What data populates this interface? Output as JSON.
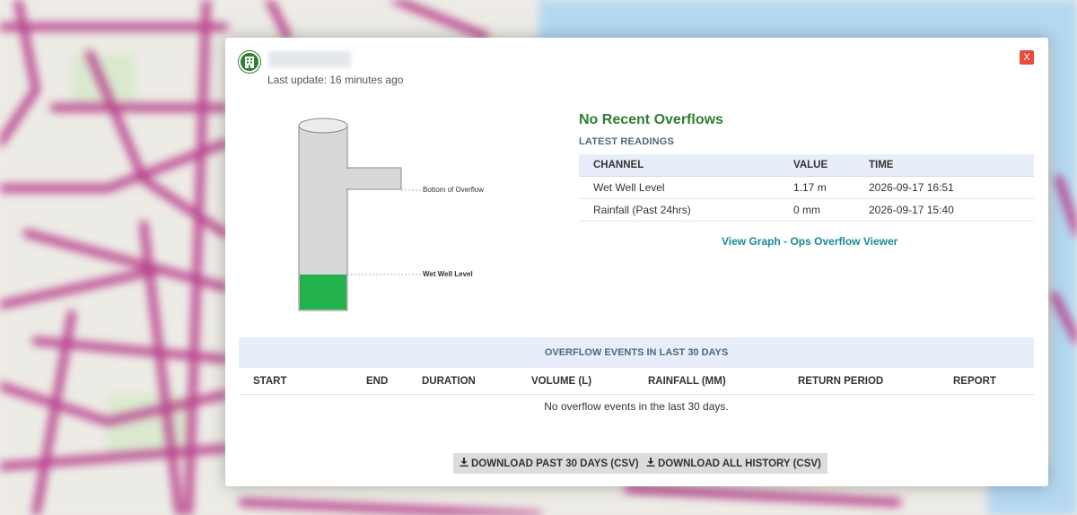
{
  "header": {
    "last_update": "Last update: 16 minutes ago",
    "close_label": "X"
  },
  "diagram": {
    "overflow_label": "Bottom of Overflow",
    "level_label": "Wet Well Level"
  },
  "status": {
    "title": "No Recent Overflows",
    "color": "#2e7d32"
  },
  "readings": {
    "title": "LATEST READINGS",
    "columns": [
      "CHANNEL",
      "VALUE",
      "TIME"
    ],
    "rows": [
      {
        "channel": "Wet Well Level",
        "value": "1.17 m",
        "time": "2026-09-17 16:51"
      },
      {
        "channel": "Rainfall (Past 24hrs)",
        "value": "0 mm",
        "time": "2026-09-17 15:40"
      }
    ],
    "graph_link": "View Graph - Ops Overflow Viewer"
  },
  "events": {
    "title": "OVERFLOW EVENTS IN LAST 30 DAYS",
    "columns": [
      "START",
      "END",
      "DURATION",
      "VOLUME (L)",
      "RAINFALL (MM)",
      "RETURN PERIOD",
      "REPORT"
    ],
    "empty_message": "No overflow events in the last 30 days."
  },
  "downloads": {
    "past_30": "DOWNLOAD PAST 30 DAYS (CSV)",
    "all_history": "DOWNLOAD ALL HISTORY (CSV)"
  },
  "colors": {
    "accent_link": "#1a8a94",
    "level_fill": "#22b14c",
    "header_bg": "#e8edfa",
    "close_bg": "#e74c3c"
  },
  "icons": [
    "building-icon",
    "download-icon"
  ]
}
